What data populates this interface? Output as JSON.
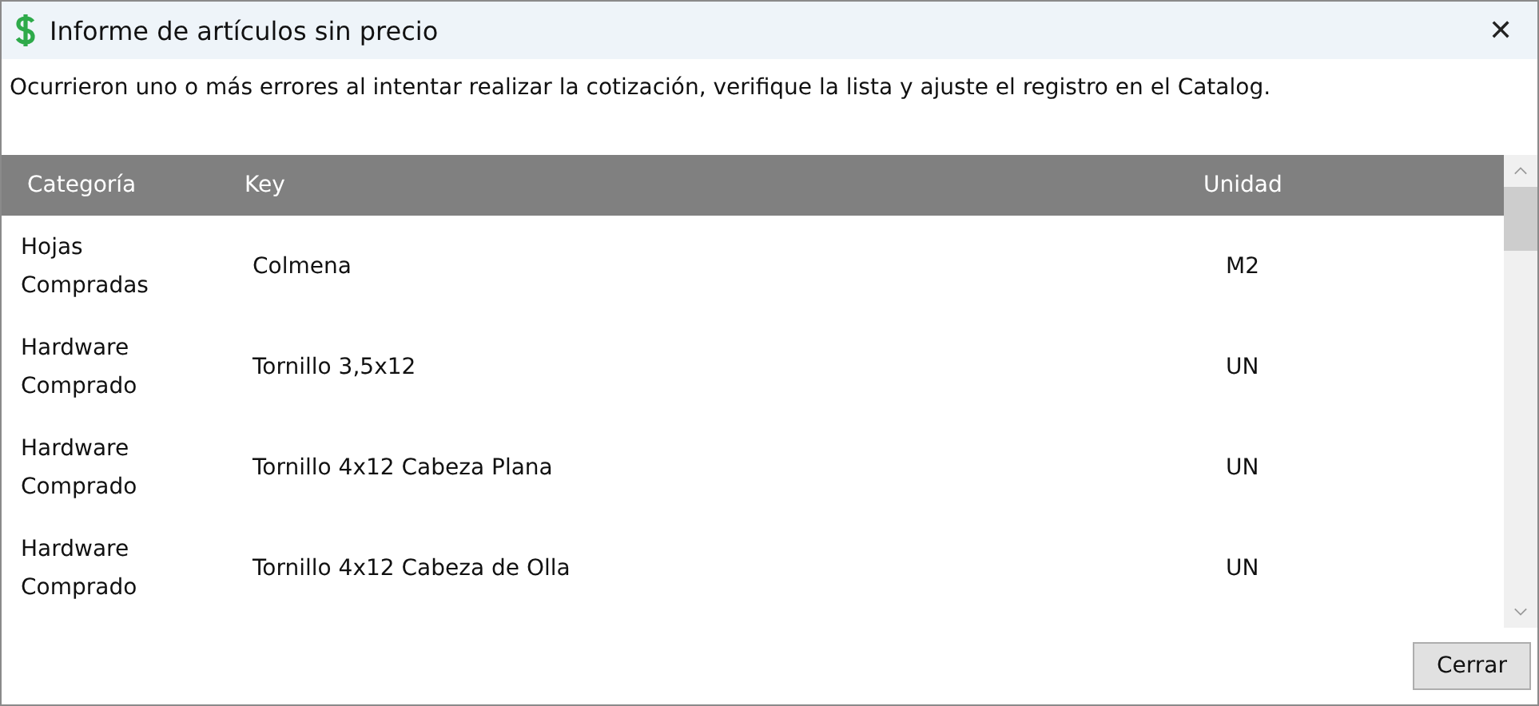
{
  "window": {
    "title": "Informe de artículos sin precio",
    "close": "✕"
  },
  "message": "Ocurrieron uno o más errores al intentar realizar la cotización, verifique la lista y ajuste el registro en el Catalog.",
  "table": {
    "columns": [
      "Categoría",
      "Key",
      "Unidad"
    ],
    "rows": [
      [
        "Hojas Compradas",
        "Colmena",
        "M2"
      ],
      [
        "Hardware Comprado",
        "Tornillo 3,5x12",
        "UN"
      ],
      [
        "Hardware Comprado",
        "Tornillo 4x12 Cabeza Plana",
        "UN"
      ],
      [
        "Hardware Comprado",
        "Tornillo 4x12 Cabeza de Olla",
        "UN"
      ]
    ]
  },
  "buttons": [
    "Cerrar"
  ]
}
